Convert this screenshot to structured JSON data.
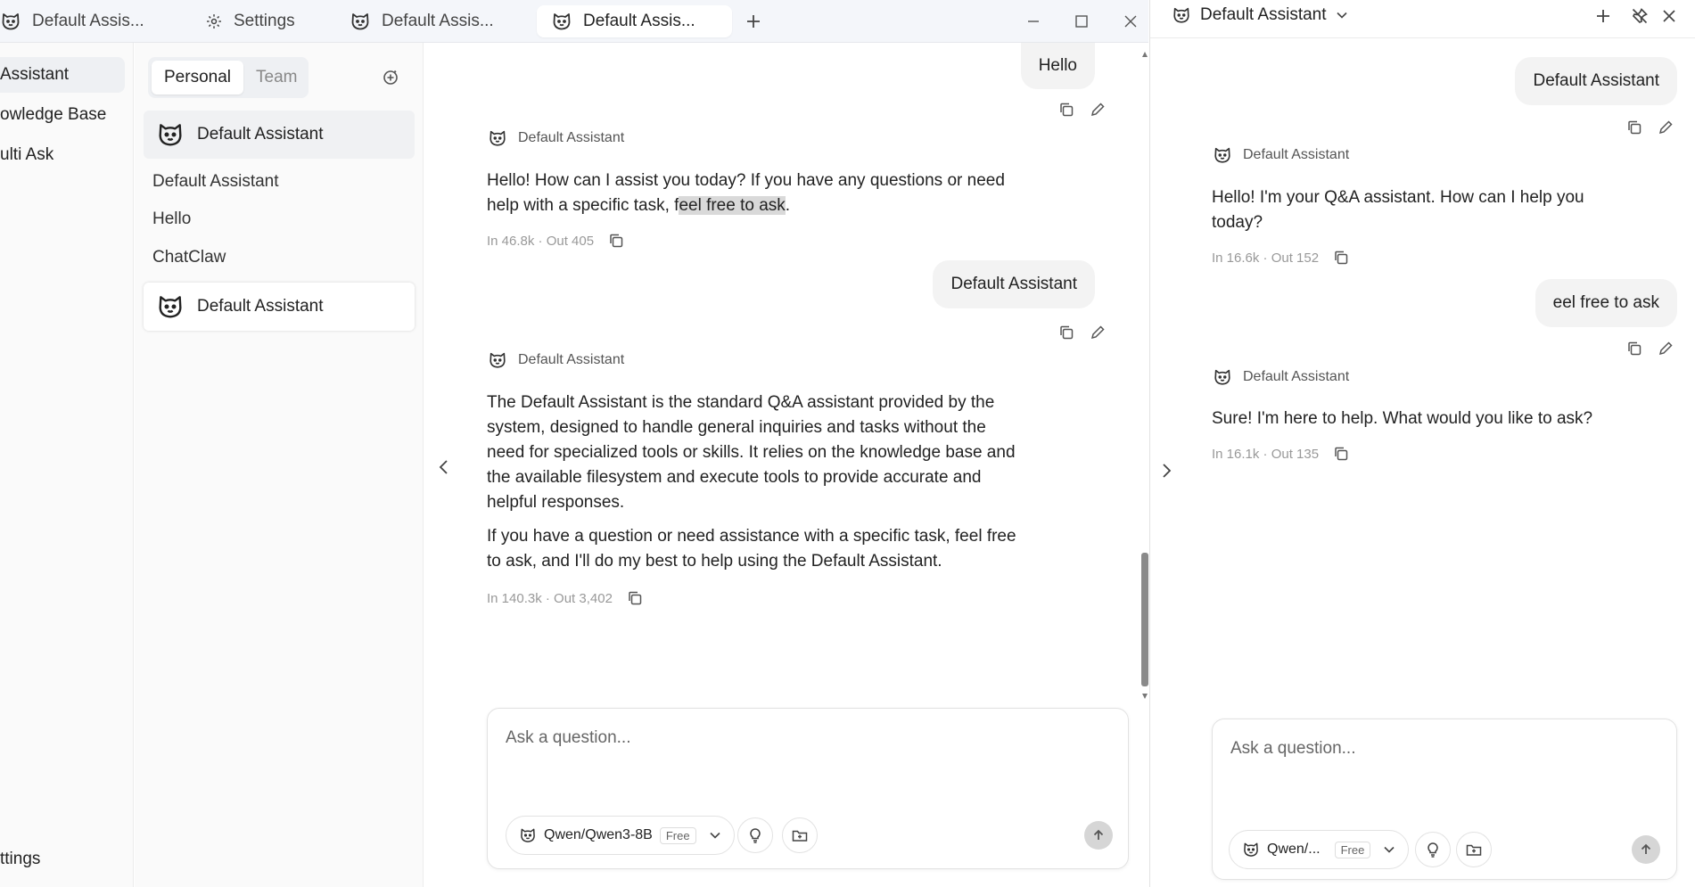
{
  "tabs": [
    {
      "label": "Default Assis...",
      "icon": "bear-icon"
    },
    {
      "label": "Settings",
      "icon": "gear-icon"
    },
    {
      "label": "Default Assis...",
      "icon": "bear-icon"
    },
    {
      "label": "Default Assis...",
      "icon": "bear-icon",
      "active": true
    }
  ],
  "nav": {
    "items": [
      "Assistant",
      "owledge Base",
      "ulti Ask"
    ],
    "settings": "ttings"
  },
  "convlist": {
    "segments": [
      "Personal",
      "Team"
    ],
    "items": [
      {
        "label": "Default Assistant",
        "avatar": true
      },
      {
        "label": "Default Assistant"
      },
      {
        "label": "Hello"
      },
      {
        "label": "ChatClaw"
      },
      {
        "label": "Default Assistant",
        "avatar": true
      }
    ]
  },
  "main_chat": {
    "user_msg_1": "Hello",
    "assistant_name": "Default Assistant",
    "reply_1_pre": "Hello! How can I assist you today? If you have any questions or need help with a specific task, f",
    "reply_1_hl": "eel free to ask",
    "reply_1_post": ".",
    "stats_1": "In 46.8k · Out 405",
    "user_msg_2": "Default Assistant",
    "reply_2_p1": "The Default Assistant is the standard Q&A assistant provided by the system, designed to handle general inquiries and tasks without the need for specialized tools or skills. It relies on the knowledge base and the available filesystem and execute tools to provide accurate and helpful responses.",
    "reply_2_p2": "If you have a question or need assistance with a specific task, feel free to ask, and I'll do my best to help using the Default Assistant.",
    "stats_2": "In 140.3k · Out 3,402",
    "composer_placeholder": "Ask a question...",
    "model": "Qwen/Qwen3-8B",
    "model_badge": "Free"
  },
  "right_panel": {
    "title": "Default Assistant",
    "user_msg_1": "Default Assistant",
    "assistant_name": "Default Assistant",
    "reply_1": "Hello! I'm your Q&A assistant. How can I help you today?",
    "stats_1": "In 16.6k · Out 152",
    "user_msg_2": "eel free to ask",
    "reply_2": "Sure! I'm here to help. What would you like to ask?",
    "stats_2": "In 16.1k · Out 135",
    "composer_placeholder": "Ask a question...",
    "model": "Qwen/...",
    "model_badge": "Free"
  },
  "colors": {
    "tabbar_bg": "#f4f6fa",
    "bubble_bg": "#f3f3f3",
    "highlight": "#d9d9d9",
    "muted_text": "#999999"
  }
}
